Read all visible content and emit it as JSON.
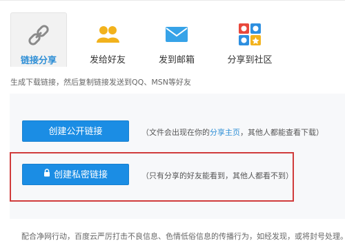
{
  "tabs": [
    {
      "label": "链接分享",
      "icon": "link-icon",
      "active": true
    },
    {
      "label": "发给好友",
      "icon": "friends-icon",
      "active": false
    },
    {
      "label": "发到邮箱",
      "icon": "mail-icon",
      "active": false
    },
    {
      "label": "分享到社区",
      "icon": "community-icon",
      "active": false
    }
  ],
  "description": "生成下载链接，然后复制链接发送到QQ、MSN等好友",
  "public_link": {
    "button_label": "创建公开链接",
    "note_prefix": "（文件会出现在你的",
    "note_link": "分享主页",
    "note_suffix": "，其他人都能查看下载）"
  },
  "private_link": {
    "button_label": "创建私密链接",
    "note": "（只有分享的好友能看到，其他人都看不到）"
  },
  "footer": "配合净网行动，百度云严厉打击不良信息、色情低俗信息的传播行为，如经发现，或将封号处理。",
  "colors": {
    "accent": "#2f8fd6",
    "button": "#1b8de4",
    "highlight_box": "#d03a3a"
  }
}
